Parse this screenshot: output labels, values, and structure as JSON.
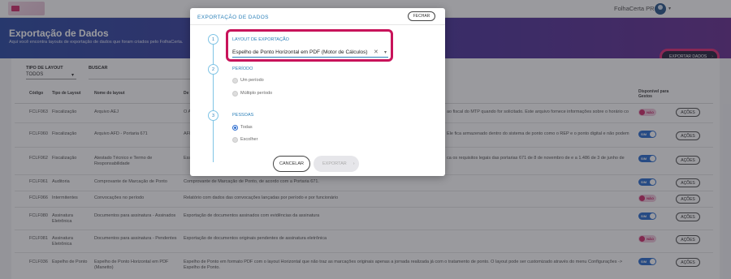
{
  "app": {
    "brand": "FolhaCerta PRO",
    "caret": "▾"
  },
  "hero": {
    "title": "Exportação de Dados",
    "subtitle": "Aqui você encontra layouts de exportação de dados que foram criados pelo FolhaCerta.",
    "export_button": "EXPORTAR DADOS",
    "export_chevron": "›"
  },
  "filters": {
    "type_label": "TIPO DE LAYOUT",
    "type_value": "TODOS",
    "type_caret": "▾",
    "search_label": "BUSCAR"
  },
  "table": {
    "headers": [
      "Código",
      "Tipo de Layout",
      "Nome do layout",
      "De",
      "Disponível para Gestos"
    ],
    "rows": [
      {
        "code": "FCLF063",
        "type": "Fiscalização",
        "name": "Arquivo AEJ",
        "desc": "O A",
        "desc2": "ao fiscal do MTP quando for solicitado. Este arquivo fornece informações sobre o horário co",
        "enabled": false,
        "toggle": "NÃO",
        "action": "AÇÕES"
      },
      {
        "code": "FCLF060",
        "type": "Fiscalização",
        "name": "Arquivo AFD - Portaria 671",
        "desc": "AFI",
        "desc2": "Ele fica armazenado dentro do sistema de ponto como o REP e o ponto digital e não podem",
        "enabled": true,
        "toggle": "SIM",
        "action": "AÇÕES"
      },
      {
        "code": "FCLF062",
        "type": "Fiscalização",
        "name": "Atestado Técnico e Termo de Responsabilidade",
        "desc": "Ess",
        "desc2": "ca os requisitos legais das portarias 671 de 8 de novembro de e a 1.486 de 3 de junho de",
        "enabled": true,
        "toggle": "SIM",
        "action": "AÇÕES"
      },
      {
        "code": "FCLF061",
        "type": "Auditoria",
        "name": "Comprovante de Marcação de Ponto",
        "desc": "Comprovante de Marcação de Ponto, de acordo com a Portaria 671.",
        "desc2": "",
        "enabled": true,
        "toggle": "SIM",
        "action": "AÇÕES"
      },
      {
        "code": "FCLF066",
        "type": "Intermitentes",
        "name": "Convocações no período",
        "desc": "Relatório com dados das convocações lançadas por período e por funcionário",
        "desc2": "",
        "enabled": false,
        "toggle": "NÃO",
        "action": "AÇÕES"
      },
      {
        "code": "FCLF080",
        "type": "Assinatura Eletrônica",
        "name": "Documentos para assinatura - Assinados",
        "desc": "Exportação de documentos assinados com evidências da assinatura",
        "desc2": "",
        "enabled": true,
        "toggle": "SIM",
        "action": "AÇÕES"
      },
      {
        "code": "FCLF081",
        "type": "Assinatura Eletrônica",
        "name": "Documentos para assinatura - Pendentes",
        "desc": "Exportação de documentos originais pendentes de assinatura eletrônica",
        "desc2": "",
        "enabled": false,
        "toggle": "NÃO",
        "action": "AÇÕES"
      },
      {
        "code": "FCLF036",
        "type": "Espelho de Ponto",
        "name": "Espelho de Ponto Horizontal em PDF (Manetto)",
        "desc": "Espelho de Ponto em formato PDF com o layout Horizontal que não traz as marcações originais apenas a jornada realizada já com o tratamento de ponto. O layout pode ser customizado através do menu Configurações -> Espelho de Ponto.",
        "desc2": "",
        "enabled": true,
        "toggle": "SIM",
        "action": "AÇÕES"
      }
    ]
  },
  "modal": {
    "title": "EXPORTAÇÃO DE DADOS",
    "close": "FECHAR",
    "steps": [
      "1",
      "2",
      "3"
    ],
    "layout_label": "LAYOUT DE EXPORTAÇÃO",
    "layout_value": "Espelho de Ponto Horizontal em PDF (Motor de Cálculos)",
    "clear_glyph": "✕",
    "caret_glyph": "▾",
    "period_label": "PERÍODO",
    "period_options": [
      {
        "label": "Um período",
        "checked": false
      },
      {
        "label": "Múltiplo período",
        "checked": false
      }
    ],
    "people_label": "PESSOAS",
    "people_options": [
      {
        "label": "Todas",
        "checked": true
      },
      {
        "label": "Escolher",
        "checked": false
      }
    ],
    "cancel": "CANCELAR",
    "submit": "EXPORTAR",
    "submit_chevron": "›"
  },
  "colors": {
    "accent": "#2a7fb8",
    "highlight": "#c8135a",
    "toggle_on": "#2f6fd0",
    "toggle_off": "#f1c8dc"
  }
}
